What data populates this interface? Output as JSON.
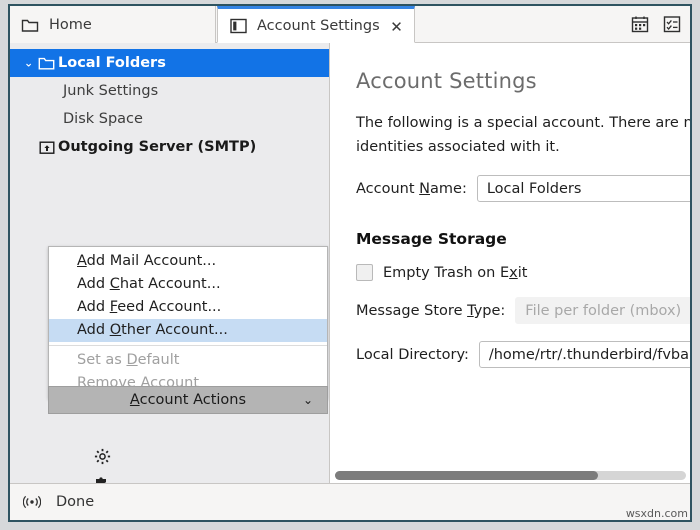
{
  "window": {
    "border_color": "#2e5360",
    "accent_color": "#1273e6",
    "tab_active_border_color": "#3584e4",
    "menu_highlight_color": "#c6dcf3"
  },
  "tabbar": {
    "tabs": [
      {
        "label": "Home",
        "icon": "folder-icon",
        "active": false
      },
      {
        "label": "Account Settings",
        "icon": "panel-layout-icon",
        "active": true
      }
    ],
    "close_label": "✕",
    "toolbar_icons": [
      {
        "name": "calendar-icon"
      },
      {
        "name": "tasks-icon"
      }
    ]
  },
  "sidebar": {
    "accounts": [
      {
        "label": "Local Folders",
        "icon": "folder-icon",
        "selected": true,
        "twisty": "⌄",
        "level": 0
      },
      {
        "label": "Junk Settings",
        "icon": "",
        "selected": false,
        "twisty": "",
        "level": 1
      },
      {
        "label": "Disk Space",
        "icon": "",
        "selected": false,
        "twisty": "",
        "level": 1
      },
      {
        "label": "Outgoing Server (SMTP)",
        "icon": "outgoing-server-icon",
        "selected": false,
        "twisty": "",
        "level": 0
      }
    ],
    "menu": {
      "items": [
        {
          "pre": "",
          "accel": "A",
          "post": "dd Mail Account...",
          "disabled": false,
          "highlighted": false
        },
        {
          "pre": "Add ",
          "accel": "C",
          "post": "hat Account...",
          "disabled": false,
          "highlighted": false
        },
        {
          "pre": "Add ",
          "accel": "F",
          "post": "eed Account...",
          "disabled": false,
          "highlighted": false
        },
        {
          "pre": "Add ",
          "accel": "O",
          "post": "ther Account...",
          "disabled": false,
          "highlighted": true
        },
        {
          "separator": true
        },
        {
          "pre": "Set as ",
          "accel": "D",
          "post": "efault",
          "disabled": true,
          "highlighted": false
        },
        {
          "pre": "",
          "accel": "R",
          "post": "emove Account",
          "disabled": true,
          "highlighted": false
        }
      ]
    },
    "account_actions": {
      "accel": "A",
      "post": "ccount Actions",
      "chevron": "⌄"
    },
    "tools": [
      {
        "name": "gear-icon"
      },
      {
        "name": "addons-puzzle-icon"
      }
    ]
  },
  "content": {
    "title": "Account Settings",
    "description": "The following is a special account. There are no identities associated with it.",
    "account_name": {
      "label_pre": "Account ",
      "label_accel": "N",
      "label_post": "ame:",
      "value": "Local Folders"
    },
    "message_storage": {
      "section_title": "Message Storage",
      "empty_trash": {
        "label_pre": "Empty Trash on E",
        "label_accel": "x",
        "label_post": "it",
        "checked": false
      },
      "store_type": {
        "label_pre": "Message Store ",
        "label_accel": "T",
        "label_post": "ype:",
        "value": "File per folder (mbox)",
        "arrow": "⌄",
        "disabled": true
      },
      "local_directory": {
        "label": "Local Directory:",
        "value": "/home/rtr/.thunderbird/fvbah"
      }
    },
    "scrollbar": {
      "thumb_percent": 75
    }
  },
  "statusbar": {
    "icon": "broadcast-icon",
    "text": "Done",
    "watermark": "wsxdn.com"
  }
}
